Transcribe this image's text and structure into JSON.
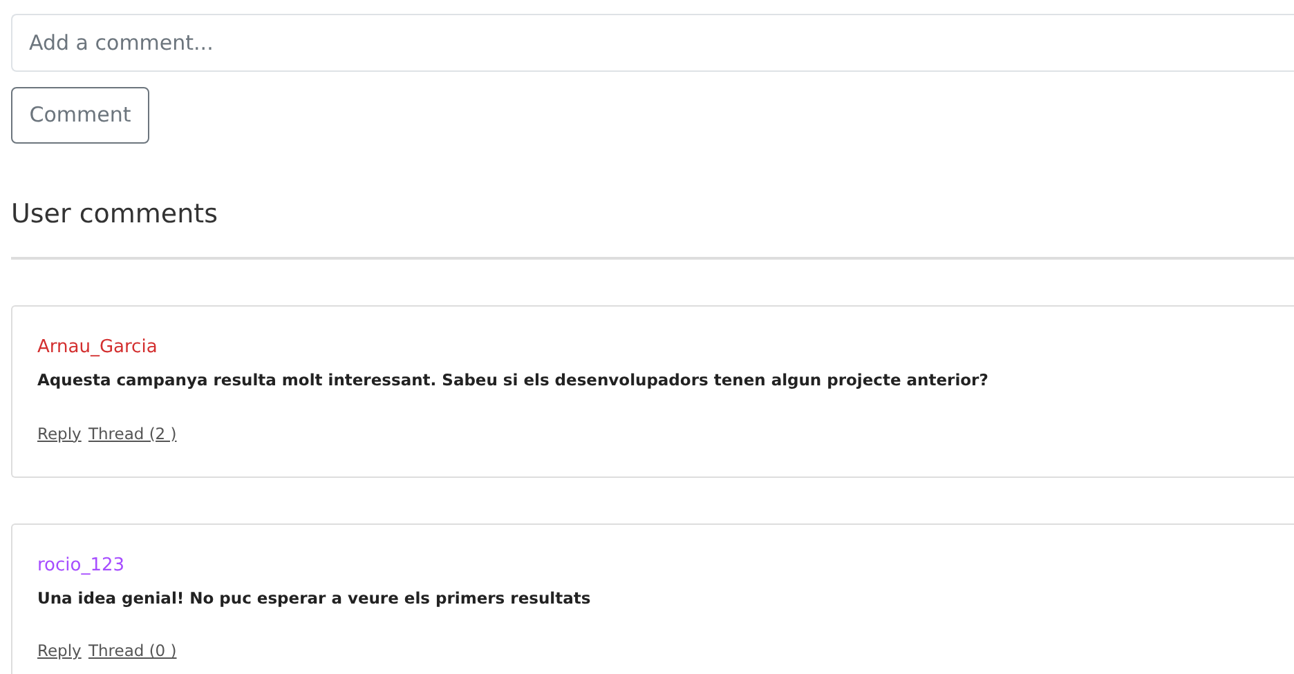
{
  "comment_form": {
    "placeholder": "Add a comment...",
    "button": "Comment"
  },
  "section_title": "User comments",
  "comments": [
    {
      "author": "Arnau_Garcia",
      "color": "#d32f2f",
      "text": "Aquesta campanya resulta molt interessant. Sabeu si els desenvolupadors tenen algun projecte anterior?",
      "reply": "Reply",
      "thread": "Thread (2 )"
    },
    {
      "author": "rocio_123",
      "color": "#a64dff",
      "text": "Una idea genial! No puc esperar a veure els primers resultats",
      "reply": "Reply",
      "thread": "Thread (0 )"
    }
  ]
}
